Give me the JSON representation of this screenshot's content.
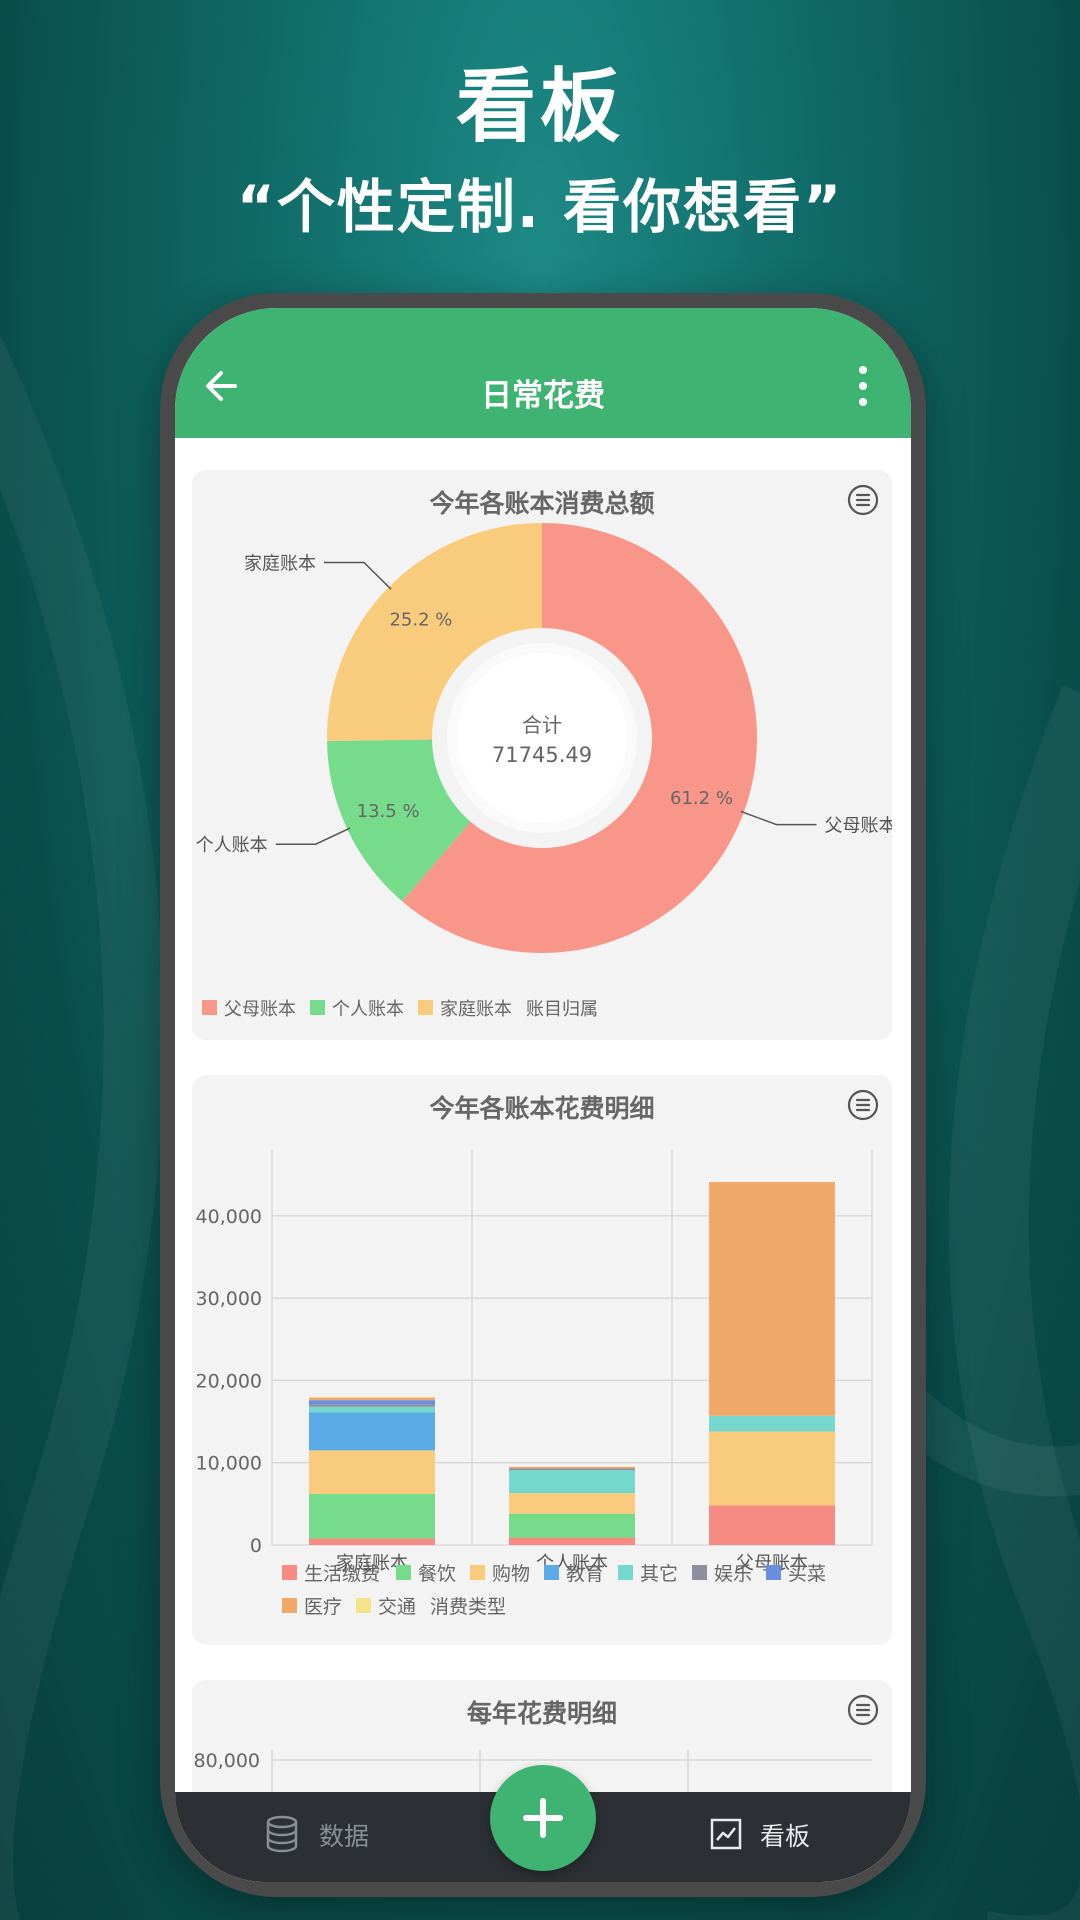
{
  "promo": {
    "title": "看板",
    "subtitle": "“个性定制. 看你想看”"
  },
  "appbar": {
    "title": "日常花费",
    "back_icon": "arrow-left-icon",
    "more_icon": "more-vertical-icon"
  },
  "colors": {
    "accent": "#3eb372",
    "parents": "#f9968a",
    "personal": "#76db8b",
    "family": "#f9cb7d"
  },
  "card1": {
    "title": "今年各账本消费总额",
    "center_label": "合计",
    "center_value": "71745.49",
    "legend_title": "账目归属",
    "menu_icon": "list-menu-icon"
  },
  "card2": {
    "title": "今年各账本花费明细",
    "legend_title": "消费类型",
    "menu_icon": "list-menu-icon"
  },
  "card3": {
    "title": "每年花费明细",
    "y_tick_top": "80,000",
    "menu_icon": "list-menu-icon"
  },
  "nav": {
    "data_label": "数据",
    "board_label": "看板",
    "data_icon": "database-icon",
    "board_icon": "chart-icon",
    "fab_icon": "plus-icon"
  },
  "chart_data": [
    {
      "type": "pie",
      "title": "今年各账本消费总额",
      "total_label": "合计",
      "total": 71745.49,
      "slices": [
        {
          "name": "父母账本",
          "percent": 61.2,
          "label": "61.2 %",
          "color": "#f9968a"
        },
        {
          "name": "个人账本",
          "percent": 13.5,
          "label": "13.5 %",
          "color": "#76db8b"
        },
        {
          "name": "家庭账本",
          "percent": 25.2,
          "label": "25.2 %",
          "color": "#f9cb7d"
        }
      ],
      "legend_title": "账目归属",
      "legend_position": "bottom-left"
    },
    {
      "type": "bar",
      "stacked": true,
      "title": "今年各账本花费明细",
      "categories": [
        "家庭账本",
        "个人账本",
        "父母账本"
      ],
      "ylim": [
        0,
        48000
      ],
      "y_ticks": [
        {
          "value": 0,
          "label": "0"
        },
        {
          "value": 10000,
          "label": "10,000"
        },
        {
          "value": 20000,
          "label": "20,000"
        },
        {
          "value": 30000,
          "label": "30,000"
        },
        {
          "value": 40000,
          "label": "40,000"
        }
      ],
      "grid": true,
      "legend_title": "消费类型",
      "legend_position": "bottom",
      "series": [
        {
          "name": "生活缴费",
          "color": "#f58b83",
          "values": [
            800,
            900,
            4800
          ]
        },
        {
          "name": "餐饮",
          "color": "#76db8b",
          "values": [
            5400,
            2900,
            0
          ]
        },
        {
          "name": "购物",
          "color": "#f9cb7d",
          "values": [
            5300,
            2500,
            9000
          ]
        },
        {
          "name": "教育",
          "color": "#5aabe6",
          "values": [
            4600,
            0,
            0
          ]
        },
        {
          "name": "其它",
          "color": "#76d7cf",
          "values": [
            700,
            2800,
            1900
          ]
        },
        {
          "name": "娱乐",
          "color": "#8b8fa0",
          "values": [
            300,
            200,
            0
          ]
        },
        {
          "name": "买菜",
          "color": "#6b8fe0",
          "values": [
            500,
            0,
            0
          ]
        },
        {
          "name": "医疗",
          "color": "#f0a86b",
          "values": [
            300,
            200,
            28400
          ]
        },
        {
          "name": "交通",
          "color": "#f3e38a",
          "values": [
            100,
            0,
            0
          ]
        }
      ]
    },
    {
      "type": "bar",
      "title": "每年花费明细",
      "y_ticks": [
        {
          "value": 80000,
          "label": "80,000"
        }
      ],
      "grid": true
    }
  ]
}
